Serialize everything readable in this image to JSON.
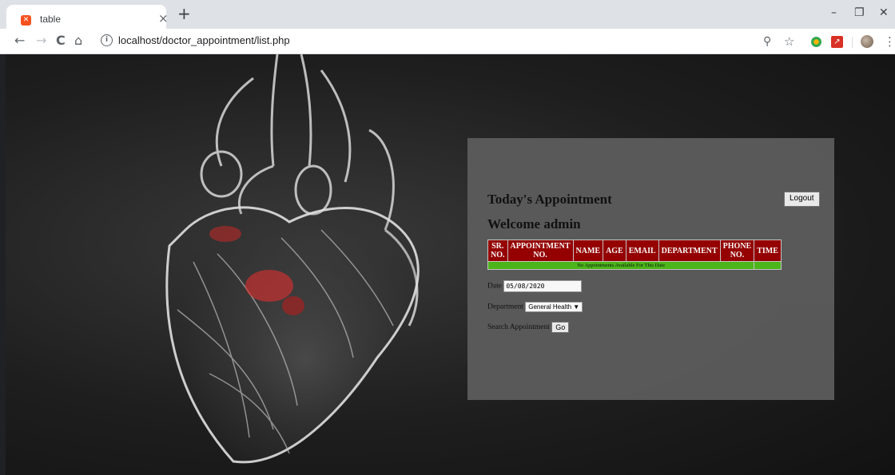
{
  "browser": {
    "tab_title": "table",
    "tab_close": "×",
    "new_tab": "+",
    "url": "localhost/doctor_appointment/list.php",
    "window_controls": {
      "minimize": "–",
      "restore": "❐",
      "close": "✕"
    },
    "nav": {
      "back": "←",
      "forward": "→",
      "reload": "C",
      "home": "⌂"
    },
    "info_icon": "i",
    "zoom_icon": "⚲",
    "bookmark_icon": "☆",
    "menu_icon": "⋮",
    "ext_pdf_label": "↗"
  },
  "page": {
    "title": "Today's Appointment",
    "welcome": "Welcome admin",
    "logout_label": "Logout",
    "table": {
      "headers": [
        {
          "line1": "SR.",
          "line2": "NO."
        },
        {
          "line1": "APPOINTMENT",
          "line2": "NO."
        },
        {
          "line1": "NAME",
          "line2": ""
        },
        {
          "line1": "AGE",
          "line2": ""
        },
        {
          "line1": "EMAIL",
          "line2": ""
        },
        {
          "line1": "DEPARTMENT",
          "line2": ""
        },
        {
          "line1": "PHONE",
          "line2": "NO."
        },
        {
          "line1": "TIME",
          "line2": ""
        }
      ],
      "empty_message": "No Appointments Available For This Date"
    },
    "form": {
      "date_label": "Date",
      "date_value": "05/08/2020",
      "department_label": "Department",
      "department_value": "General Health ▼",
      "search_label": "Search Appointment",
      "go_label": "Go"
    }
  },
  "colors": {
    "header_bg": "#990000",
    "empty_row_bg": "#4dba1a",
    "panel_bg": "#5b5b5b"
  }
}
